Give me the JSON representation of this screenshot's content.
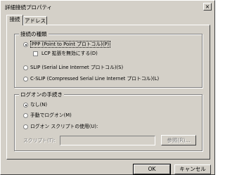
{
  "window": {
    "title": "詳細接続プロパティ",
    "close_glyph": "×"
  },
  "tabs": [
    {
      "label": "接続",
      "active": true
    },
    {
      "label": "アドレス",
      "active": false
    }
  ],
  "connection_type_group": {
    "title": "接続の種類",
    "options": [
      {
        "label": "PPP (Point to Point プロトコル)(P)",
        "checked": true
      },
      {
        "label": "SLIP (Serial Line Internet プロトコル)(S)",
        "checked": false
      },
      {
        "label": "C-SLIP (Compressed Serial Line Internet プロトコル)(L)",
        "checked": false
      }
    ],
    "lcp_checkbox": {
      "label": "LCP 拡張を無効にする(D)",
      "checked": false
    }
  },
  "logon_group": {
    "title": "ログオンの手続き",
    "options": [
      {
        "label": "なし(N)",
        "checked": true
      },
      {
        "label": "手動でログオン(M)",
        "checked": false
      },
      {
        "label": "ログオン スクリプトの使用(U):",
        "checked": false
      }
    ],
    "script_label": "スクリプト(T):",
    "script_value": "",
    "browse_button": "参照(R)..."
  },
  "footer": {
    "ok_button": "OK",
    "cancel_button": "キャンセル"
  }
}
